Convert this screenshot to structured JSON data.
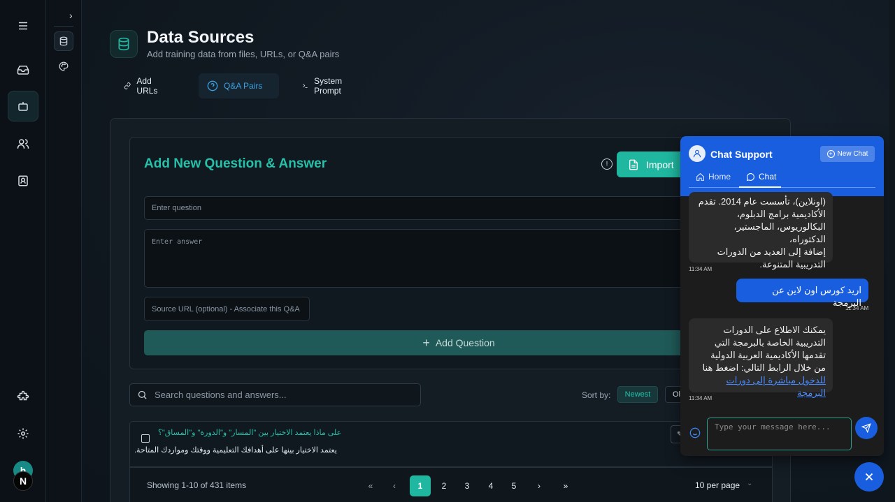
{
  "header": {
    "title": "Data Sources",
    "subtitle": "Add training data from files, URLs, or Q&A pairs"
  },
  "tabs": [
    {
      "label": "Add URLs",
      "icon": "link-icon",
      "active": false
    },
    {
      "label": "Q&A Pairs",
      "icon": "question-circle-icon",
      "active": true
    },
    {
      "label": "System Prompt",
      "icon": "terminal-icon",
      "active": false
    }
  ],
  "qa_form": {
    "title": "Add New Question & Answer",
    "import_label": "Import",
    "question_placeholder": "Enter question",
    "answer_placeholder": "Enter answer",
    "source_placeholder": "Source URL (optional) - Associate this Q&A",
    "add_label": "Add Question"
  },
  "list": {
    "search_placeholder": "Search questions and answers...",
    "sort_label": "Sort by:",
    "sort_newest": "Newest",
    "sort_oldest": "Oldest",
    "rows": [
      {
        "question": "على ماذا يعتمد الاختيار بين \"المسار\" و\"الدورة\" و\"المساق\"؟",
        "answer": "يعتمد الاختيار بينها على أهدافك التعليمية ووقتك ومواردك المتاحة."
      }
    ],
    "pagination": {
      "info": "Showing 1-10 of 431 items",
      "pages": [
        "1",
        "2",
        "3",
        "4",
        "5"
      ],
      "current": 1,
      "first": "«",
      "prev": "‹",
      "next": "›",
      "last": "»",
      "per_page": "10 per page"
    }
  },
  "chat": {
    "title": "Chat Support",
    "new_chat_label": "New Chat",
    "tabs": [
      {
        "label": "Home",
        "icon": "home-icon"
      },
      {
        "label": "Chat",
        "icon": "chat-bubble-icon"
      }
    ],
    "messages": [
      {
        "role": "bot",
        "lines": [
          "(اونلاين)، تأسست عام 2014. تقدم",
          "الأكاديمية برامج الدبلوم،",
          "البكالوريوس، الماجستير، الدكتوراه،",
          "إضافة إلى العديد من الدورات",
          "التدريبية المتنوعة."
        ],
        "time": "11:34 AM"
      },
      {
        "role": "user",
        "lines": [
          "اريد كورس اون لاين عن البرمجة"
        ],
        "time": "11:34 AM"
      },
      {
        "role": "bot",
        "lines": [
          "يمكنك الاطلاع على الدورات",
          "التدريبية الخاصة بالبرمجة التي",
          "تقدمها الأكاديمية العربية الدولية",
          "من خلال الرابط التالي: اضغط هنا"
        ],
        "link_line": "للدخول مباشرة إلى دورات البرمجة",
        "time": "11:34 AM"
      }
    ],
    "input_placeholder": "Type your message here..."
  },
  "profile": {
    "initial_top": "h",
    "initial_bottom": "N"
  },
  "colors": {
    "accent": "#1fb7a0",
    "chat_blue": "#1a5ee0"
  }
}
